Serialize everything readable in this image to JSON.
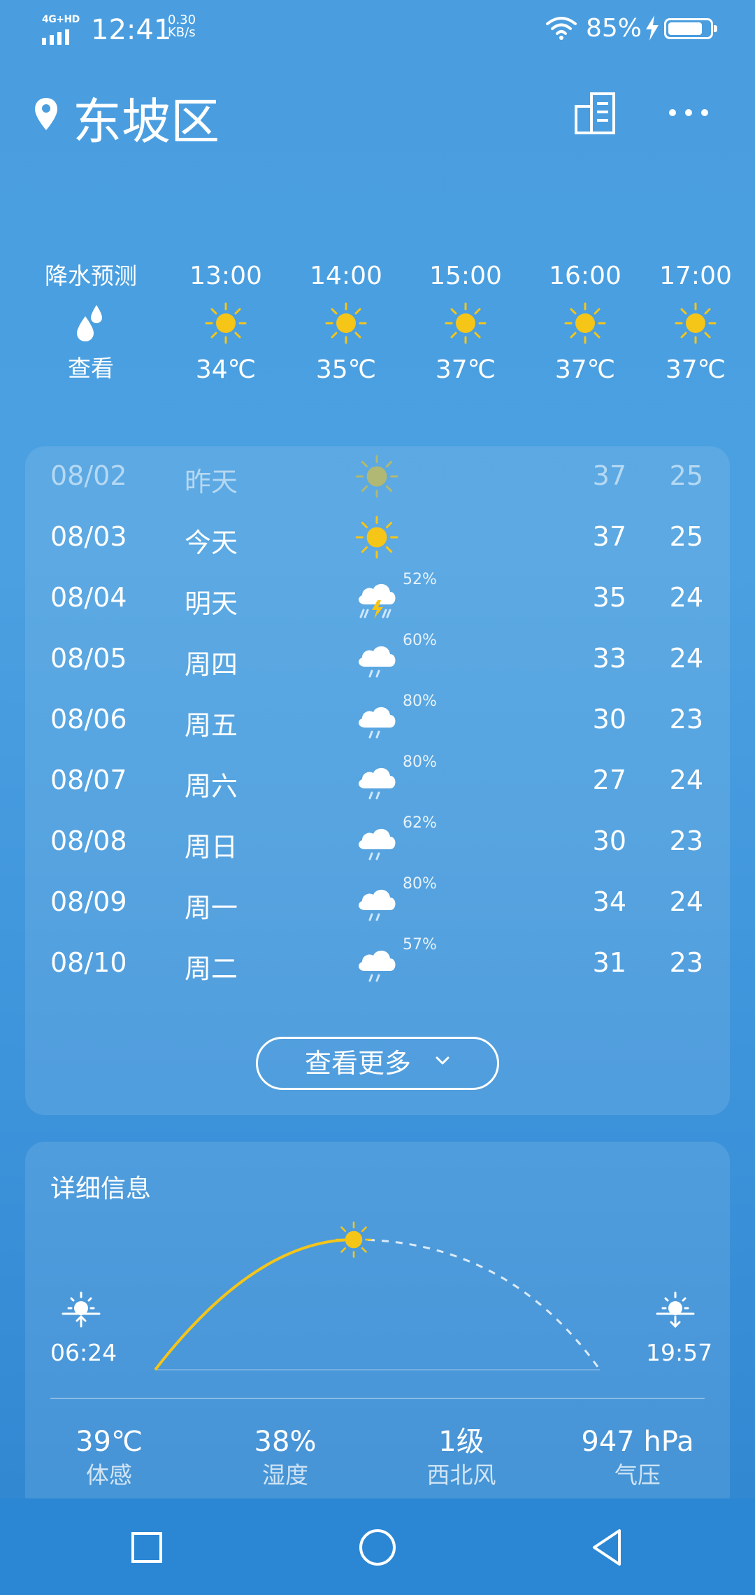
{
  "status_bar": {
    "network": "4G+HD",
    "time": "12:41",
    "speed_value": "0.30",
    "speed_unit": "KB/s",
    "battery_pct": "85%",
    "battery_level": 0.85
  },
  "header": {
    "location": "东坡区",
    "icons": [
      "location-pin-icon",
      "city-list-icon",
      "more-icon"
    ]
  },
  "hourly": {
    "precip_label": "降水预测",
    "precip_action": "查看",
    "hours": [
      {
        "time": "13:00",
        "temp": "34℃",
        "icon": "sun-icon"
      },
      {
        "time": "14:00",
        "temp": "35℃",
        "icon": "sun-icon"
      },
      {
        "time": "15:00",
        "temp": "37℃",
        "icon": "sun-icon"
      },
      {
        "time": "16:00",
        "temp": "37℃",
        "icon": "sun-icon"
      },
      {
        "time": "17:00",
        "temp": "37℃",
        "icon": "sun-icon"
      }
    ]
  },
  "daily": {
    "days": [
      {
        "date": "08/02",
        "weekday": "昨天",
        "icon": "sun-icon",
        "prob": "",
        "high": "37",
        "low": "25"
      },
      {
        "date": "08/03",
        "weekday": "今天",
        "icon": "sun-icon",
        "prob": "",
        "high": "37",
        "low": "25"
      },
      {
        "date": "08/04",
        "weekday": "明天",
        "icon": "thunderstorm-icon",
        "prob": "52%",
        "high": "35",
        "low": "24"
      },
      {
        "date": "08/05",
        "weekday": "周四",
        "icon": "rain-cloud-icon",
        "prob": "60%",
        "high": "33",
        "low": "24"
      },
      {
        "date": "08/06",
        "weekday": "周五",
        "icon": "rain-cloud-icon",
        "prob": "80%",
        "high": "30",
        "low": "23"
      },
      {
        "date": "08/07",
        "weekday": "周六",
        "icon": "rain-cloud-icon",
        "prob": "80%",
        "high": "27",
        "low": "24"
      },
      {
        "date": "08/08",
        "weekday": "周日",
        "icon": "rain-cloud-icon",
        "prob": "62%",
        "high": "30",
        "low": "23"
      },
      {
        "date": "08/09",
        "weekday": "周一",
        "icon": "rain-cloud-icon",
        "prob": "80%",
        "high": "34",
        "low": "24"
      },
      {
        "date": "08/10",
        "weekday": "周二",
        "icon": "rain-cloud-icon",
        "prob": "57%",
        "high": "31",
        "low": "23"
      }
    ],
    "more_label": "查看更多"
  },
  "detail": {
    "title": "详细信息",
    "sunrise": "06:24",
    "sunset": "19:57",
    "stats": [
      {
        "value": "39℃",
        "label": "体感"
      },
      {
        "value": "38%",
        "label": "湿度"
      },
      {
        "value": "1级",
        "label": "西北风"
      },
      {
        "value": "947 hPa",
        "label": "气压"
      }
    ]
  },
  "colors": {
    "background_top": "#4a9ee0",
    "background_bottom": "#2f86d0",
    "sun": "#f5c518",
    "text": "#ffffff"
  }
}
